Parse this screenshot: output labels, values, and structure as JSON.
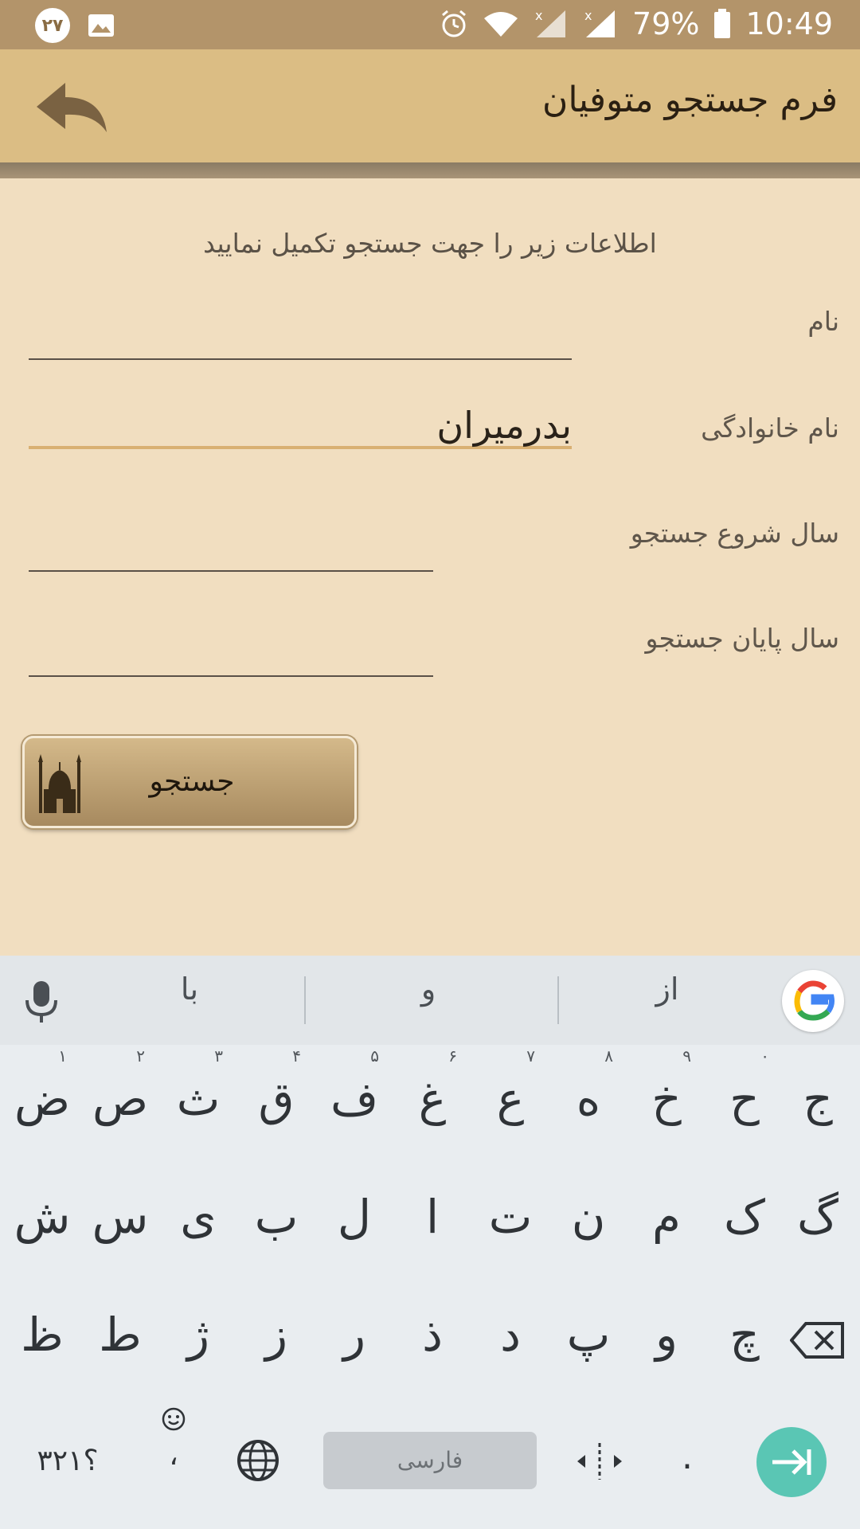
{
  "status_bar": {
    "notification_badge": "۲۷",
    "battery_percent": "79%",
    "time": "10:49",
    "icons": [
      "image-icon",
      "alarm-icon",
      "wifi-icon",
      "signal-icon",
      "signal-icon",
      "battery-icon"
    ]
  },
  "app_bar": {
    "title": "فرم جستجو متوفیان",
    "back_icon": "back-arrow-icon"
  },
  "form": {
    "intro": "اطلاعات زیر را جهت جستجو تکمیل نمایید",
    "fields": [
      {
        "label": "نام",
        "value": ""
      },
      {
        "label": "نام خانوادگی",
        "value": "بدرمیران"
      },
      {
        "label": "سال شروع جستجو",
        "value": ""
      },
      {
        "label": "سال پایان جستجو",
        "value": ""
      }
    ],
    "search_button": "جستجو",
    "search_button_icon": "mosque-icon"
  },
  "keyboard": {
    "suggestions": [
      "با",
      "و",
      "از"
    ],
    "row1": [
      {
        "key": "ض",
        "hint": "۱"
      },
      {
        "key": "ص",
        "hint": "۲"
      },
      {
        "key": "ث",
        "hint": "۳"
      },
      {
        "key": "ق",
        "hint": "۴"
      },
      {
        "key": "ف",
        "hint": "۵"
      },
      {
        "key": "غ",
        "hint": "۶"
      },
      {
        "key": "ع",
        "hint": "۷"
      },
      {
        "key": "ه",
        "hint": "۸"
      },
      {
        "key": "خ",
        "hint": "۹"
      },
      {
        "key": "ح",
        "hint": "۰"
      },
      {
        "key": "ج",
        "hint": ""
      }
    ],
    "row2": [
      "ش",
      "س",
      "ی",
      "ب",
      "ل",
      "ا",
      "ت",
      "ن",
      "م",
      "ک",
      "گ"
    ],
    "row3": [
      "ظ",
      "ط",
      "ژ",
      "ز",
      "ر",
      "ذ",
      "د",
      "پ",
      "و",
      "چ"
    ],
    "symbols_key": "؟۳۲۱",
    "comma_key": "،",
    "space_label": "فارسی",
    "period_key": ".",
    "colors": {
      "enter": "#5ac6b4",
      "app_bar": "#dbbd84",
      "status_bar": "#b3946a"
    }
  }
}
